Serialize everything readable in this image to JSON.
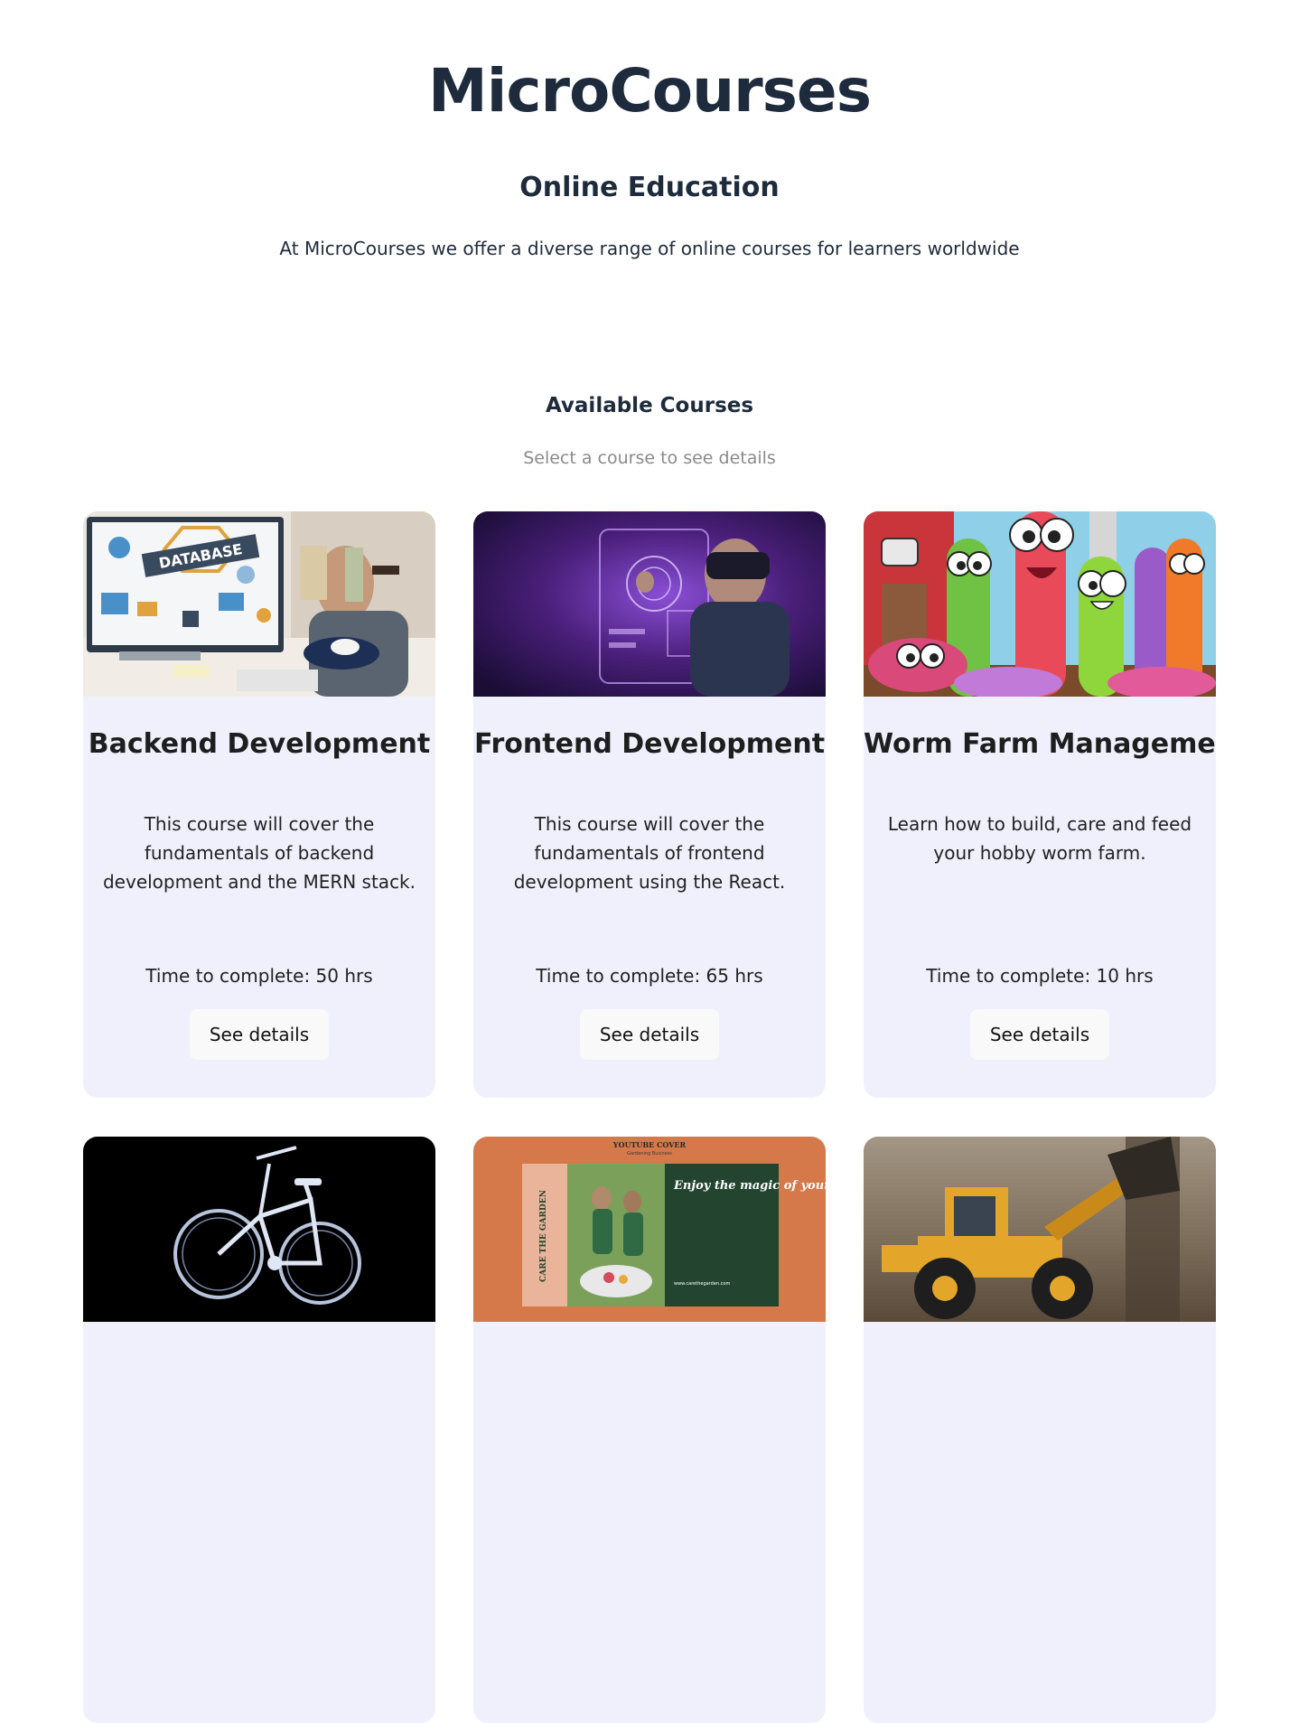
{
  "header": {
    "title": "MicroCourses",
    "subtitle": "Online Education",
    "tagline": "At MicroCourses we offer a diverse range of online courses for learners worldwide"
  },
  "courses_section": {
    "title": "Available Courses",
    "subtitle": "Select a course to see details"
  },
  "courses": [
    {
      "title": "Backend Development",
      "description": "This course will cover the fundamentals of backend development and the MERN stack.",
      "time_label": "Time to complete: 50 hrs",
      "button_label": "See details",
      "image_icon": "database-photo",
      "image_text": "DATABASE"
    },
    {
      "title": "Frontend Development",
      "description": "This course will cover the fundamentals of frontend development using the React.",
      "time_label": "Time to complete: 65 hrs",
      "button_label": "See details",
      "image_icon": "vr-headset-photo"
    },
    {
      "title": "Worm Farm Management",
      "description": "Learn how to build, care and feed your hobby worm farm.",
      "time_label": "Time to complete: 10 hrs",
      "button_label": "See details",
      "image_icon": "cartoon-worms-illustration"
    },
    {
      "title": "",
      "description": "",
      "time_label": "",
      "button_label": "",
      "image_icon": "xray-bicycle-photo"
    },
    {
      "title": "",
      "description": "",
      "time_label": "",
      "button_label": "",
      "image_icon": "garden-youtube-cover",
      "image_heading": "YOUTUBE COVER",
      "image_subheading": "Gardening Business",
      "image_text": "Enjoy the magic of your garden",
      "image_side_text": "CARE THE GARDEN",
      "image_url_text": "www.carethegarden.com"
    },
    {
      "title": "",
      "description": "",
      "time_label": "",
      "button_label": "",
      "image_icon": "wheel-loader-photo"
    }
  ],
  "colors": {
    "text_dark": "#1e2b3c",
    "card_bg": "#eff0fc",
    "muted": "#8a8a8a",
    "button_bg": "#f9f9f9"
  }
}
